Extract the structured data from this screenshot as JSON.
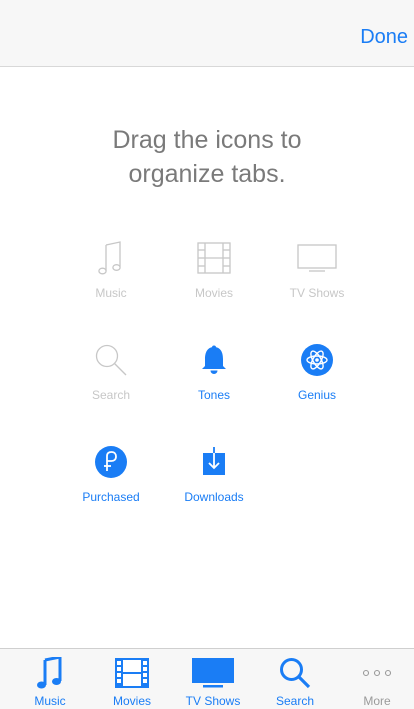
{
  "nav": {
    "done_label": "Done"
  },
  "instruction": {
    "line1": "Drag the icons to",
    "line2": "organize tabs."
  },
  "grid": [
    {
      "label": "Music",
      "icon": "music-note-icon",
      "active": false
    },
    {
      "label": "Movies",
      "icon": "film-icon",
      "active": false
    },
    {
      "label": "TV Shows",
      "icon": "tv-icon",
      "active": false
    },
    {
      "label": "Search",
      "icon": "search-icon",
      "active": false
    },
    {
      "label": "Tones",
      "icon": "bell-icon",
      "active": true
    },
    {
      "label": "Genius",
      "icon": "atom-icon",
      "active": true
    },
    {
      "label": "Purchased",
      "icon": "purchased-icon",
      "active": true
    },
    {
      "label": "Downloads",
      "icon": "download-icon",
      "active": true
    }
  ],
  "tabs": [
    {
      "label": "Music",
      "icon": "music-note-icon"
    },
    {
      "label": "Movies",
      "icon": "film-icon"
    },
    {
      "label": "TV Shows",
      "icon": "tv-icon"
    },
    {
      "label": "Search",
      "icon": "search-icon"
    },
    {
      "label": "More",
      "icon": "more-dots-icon"
    }
  ],
  "colors": {
    "accent": "#1a7df5",
    "inactive": "#c7c7c7",
    "instruction": "#7a7a7a"
  }
}
